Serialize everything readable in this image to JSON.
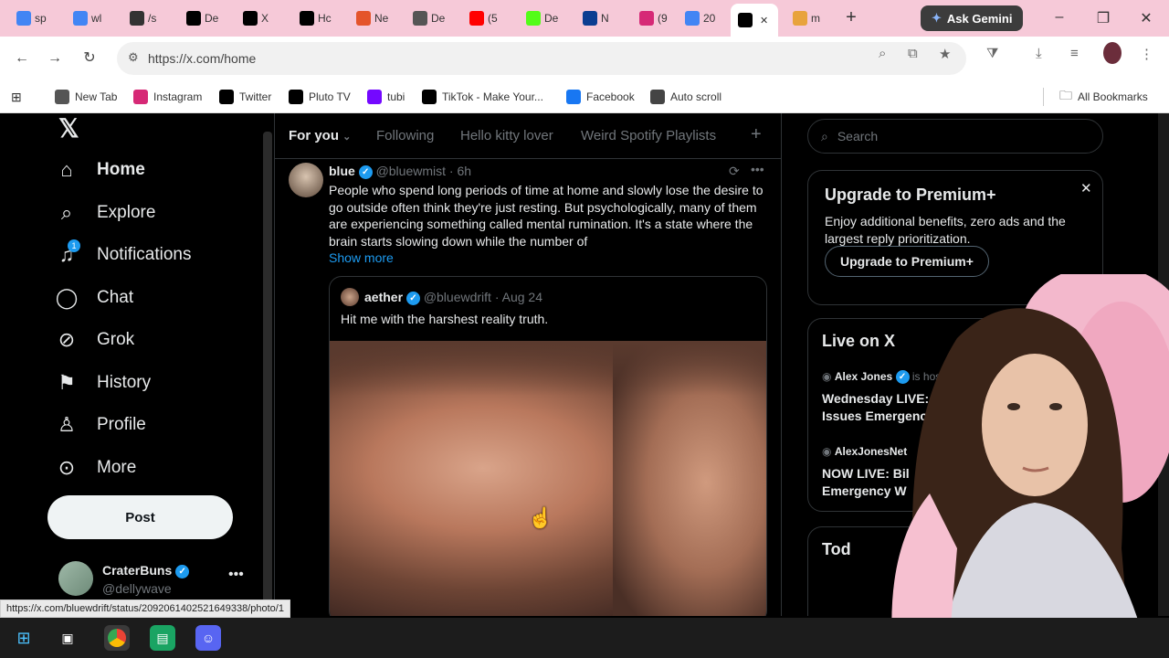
{
  "browser": {
    "tabs": [
      {
        "label": "sp",
        "icon": "google-icon",
        "color": "#4285f4"
      },
      {
        "label": "wl",
        "icon": "google-icon",
        "color": "#4285f4"
      },
      {
        "label": "/s",
        "icon": "fandom-icon",
        "color": "#333333"
      },
      {
        "label": "De",
        "icon": "tiktok-icon",
        "color": "#000000"
      },
      {
        "label": "X",
        "icon": "x-icon",
        "color": "#000000"
      },
      {
        "label": "Hc",
        "icon": "x-icon",
        "color": "#000000"
      },
      {
        "label": "Ne",
        "icon": "news-icon",
        "color": "#e4542b"
      },
      {
        "label": "De",
        "icon": "calendar-icon",
        "color": "#555555"
      },
      {
        "label": "(5",
        "icon": "youtube-icon",
        "color": "#ff0000"
      },
      {
        "label": "De",
        "icon": "kick-icon",
        "color": "#53fc18"
      },
      {
        "label": "N",
        "icon": "nasa-icon",
        "color": "#0b3d91"
      },
      {
        "label": "(9",
        "icon": "instagram-icon",
        "color": "#d62976"
      },
      {
        "label": "20",
        "icon": "google-icon",
        "color": "#4285f4"
      },
      {
        "label": "",
        "icon": "x-icon",
        "color": "#000000",
        "active": true
      },
      {
        "label": "m",
        "icon": "misc-icon",
        "color": "#e8a33d"
      }
    ],
    "gemini_label": "Ask Gemini",
    "url": "https://x.com/home",
    "bookmarks": [
      {
        "label": "New Tab",
        "icon": "chrome-icon",
        "color": "#555555"
      },
      {
        "label": "Instagram",
        "icon": "instagram-icon",
        "color": "#d62976"
      },
      {
        "label": "Twitter",
        "icon": "x-icon",
        "color": "#000000"
      },
      {
        "label": "Pluto TV",
        "icon": "pluto-tv-icon",
        "color": "#000000"
      },
      {
        "label": "tubi",
        "icon": "tubi-icon",
        "color": "#7408ff"
      },
      {
        "label": "TikTok - Make Your...",
        "icon": "tiktok-icon",
        "color": "#000000"
      },
      {
        "label": "Facebook",
        "icon": "facebook-icon",
        "color": "#1877f2"
      },
      {
        "label": "Auto scroll",
        "icon": "auto-scroll-icon",
        "color": "#444444"
      }
    ],
    "all_bookmarks": "All Bookmarks",
    "status_url": "https://x.com/bluewdrift/status/2092061402521649338/photo/1"
  },
  "sidebar": {
    "items": [
      {
        "label": "Home",
        "icon": "home-icon"
      },
      {
        "label": "Explore",
        "icon": "search-icon"
      },
      {
        "label": "Notifications",
        "icon": "bell-icon",
        "badge": "1"
      },
      {
        "label": "Chat",
        "icon": "chat-icon"
      },
      {
        "label": "Grok",
        "icon": "grok-icon"
      },
      {
        "label": "History",
        "icon": "bookmark-icon"
      },
      {
        "label": "Profile",
        "icon": "person-icon"
      },
      {
        "label": "More",
        "icon": "more-circle-icon"
      }
    ],
    "post_label": "Post",
    "user_name": "CraterBuns",
    "user_handle": "@dellywave"
  },
  "feed": {
    "tabs": [
      "For you",
      "Following",
      "Hello kitty lover",
      "Weird Spotify Playlists"
    ],
    "tweet": {
      "name": "blue",
      "handle": "@bluewmist",
      "time": "· 6h",
      "text": "People who spend long periods of time at home and slowly lose the desire to go outside often think they're just resting. But psychologically, many of them are experiencing something called mental rumination. It's a state where the brain starts slowing down while the number of",
      "show_more": "Show more",
      "quote": {
        "name": "aether",
        "handle": "@bluewdrift",
        "time": "· Aug 24",
        "text": "Hit me with the harshest reality truth."
      }
    }
  },
  "right": {
    "search_placeholder": "Search",
    "premium": {
      "title": "Upgrade to Premium+",
      "body": "Enjoy additional benefits, zero ads and the largest reply prioritization.",
      "button": "Upgrade to Premium+"
    },
    "live": {
      "title": "Live on X",
      "items": [
        {
          "host": "Alex Jones",
          "meta": "is hosting",
          "title": "Wednesday LIVE: Bill C Issues Emergency Wa"
        },
        {
          "host": "AlexJonesNet",
          "meta": "",
          "title": "NOW LIVE: Bil Emergency W"
        }
      ]
    },
    "today_partial": "Tod"
  }
}
